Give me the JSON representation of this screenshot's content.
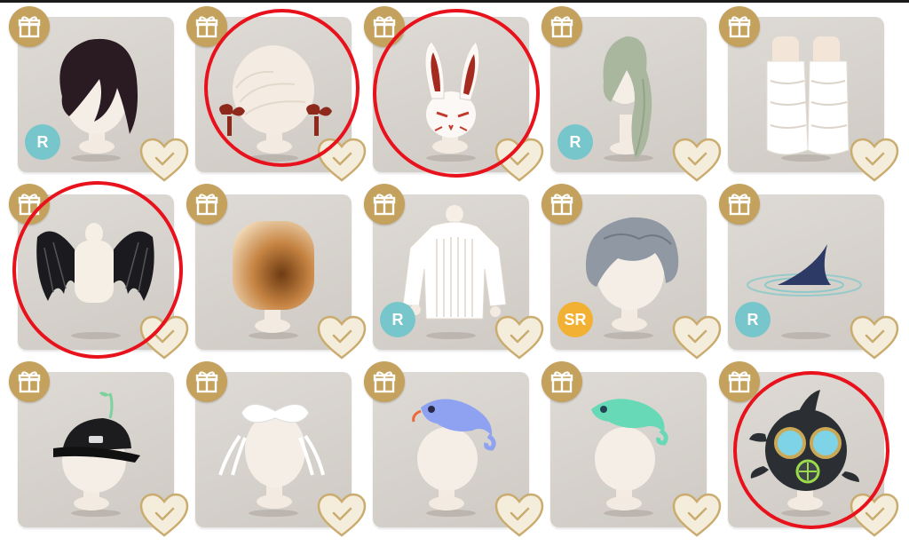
{
  "colors": {
    "gift_badge": "#c4a25d",
    "rarity_r": "#77c6cc",
    "rarity_sr": "#f2b132",
    "heart_fill": "#f5eddb",
    "heart_stroke": "#c9ac6e",
    "highlight": "#e8121c"
  },
  "items": [
    {
      "name": "dark-hair",
      "rarity": "R",
      "gift_icon": "gift-icon",
      "favorite_icon": "heart-check-icon",
      "highlighted": false
    },
    {
      "name": "twin-buns-with-red-ribbons",
      "rarity": "",
      "gift_icon": "gift-icon",
      "favorite_icon": "heart-check-icon",
      "highlighted": true
    },
    {
      "name": "white-rabbit-mask",
      "rarity": "",
      "gift_icon": "gift-icon",
      "favorite_icon": "heart-check-icon",
      "highlighted": true
    },
    {
      "name": "long-sage-hair",
      "rarity": "R",
      "gift_icon": "gift-icon",
      "favorite_icon": "heart-check-icon",
      "highlighted": false
    },
    {
      "name": "white-leg-warmers",
      "rarity": "",
      "gift_icon": "gift-icon",
      "favorite_icon": "heart-check-icon",
      "highlighted": false
    },
    {
      "name": "black-bat-wings",
      "rarity": "",
      "gift_icon": "gift-icon",
      "favorite_icon": "heart-check-icon",
      "highlighted": true
    },
    {
      "name": "toasted-marshmallow",
      "rarity": "",
      "gift_icon": "gift-icon",
      "favorite_icon": "heart-check-icon",
      "highlighted": false
    },
    {
      "name": "white-knit-sweater",
      "rarity": "R",
      "gift_icon": "gift-icon",
      "favorite_icon": "heart-check-icon",
      "highlighted": false
    },
    {
      "name": "grey-wavy-hair",
      "rarity": "SR",
      "gift_icon": "gift-icon",
      "favorite_icon": "heart-check-icon",
      "highlighted": false
    },
    {
      "name": "shark-fin",
      "rarity": "R",
      "gift_icon": "gift-icon",
      "favorite_icon": "heart-check-icon",
      "highlighted": false
    },
    {
      "name": "black-cap-with-sprout",
      "rarity": "",
      "gift_icon": "gift-icon",
      "favorite_icon": "heart-check-icon",
      "highlighted": false
    },
    {
      "name": "white-bow-headpiece",
      "rarity": "",
      "gift_icon": "gift-icon",
      "favorite_icon": "heart-check-icon",
      "highlighted": false
    },
    {
      "name": "blue-chameleon",
      "rarity": "",
      "gift_icon": "gift-icon",
      "favorite_icon": "heart-check-icon",
      "highlighted": false
    },
    {
      "name": "green-chameleon",
      "rarity": "",
      "gift_icon": "gift-icon",
      "favorite_icon": "heart-check-icon",
      "highlighted": false
    },
    {
      "name": "gas-mask-fish-helmet",
      "rarity": "",
      "gift_icon": "gift-icon",
      "favorite_icon": "heart-check-icon",
      "highlighted": true
    }
  ]
}
